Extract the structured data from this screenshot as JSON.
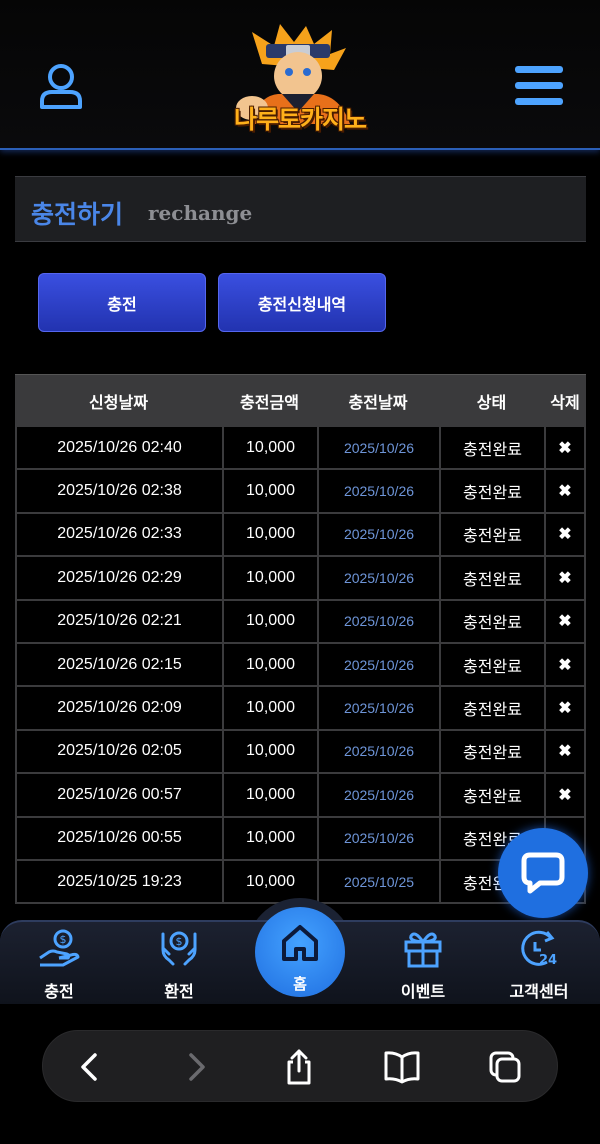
{
  "header": {
    "logo_text": "나루토카지노"
  },
  "page": {
    "title_ko": "충전하기",
    "title_en": "rechange"
  },
  "buttons": {
    "charge": "충전",
    "history": "충전신청내역"
  },
  "table": {
    "headers": [
      "신청날짜",
      "충전금액",
      "충전날짜",
      "상태",
      "삭제"
    ],
    "rows": [
      {
        "requested": "2025/10/26 02:40",
        "amount": "10,000",
        "charged": "2025/10/26",
        "status": "충전완료",
        "delete": "✖"
      },
      {
        "requested": "2025/10/26 02:38",
        "amount": "10,000",
        "charged": "2025/10/26",
        "status": "충전완료",
        "delete": "✖"
      },
      {
        "requested": "2025/10/26 02:33",
        "amount": "10,000",
        "charged": "2025/10/26",
        "status": "충전완료",
        "delete": "✖"
      },
      {
        "requested": "2025/10/26 02:29",
        "amount": "10,000",
        "charged": "2025/10/26",
        "status": "충전완료",
        "delete": "✖"
      },
      {
        "requested": "2025/10/26 02:21",
        "amount": "10,000",
        "charged": "2025/10/26",
        "status": "충전완료",
        "delete": "✖"
      },
      {
        "requested": "2025/10/26 02:15",
        "amount": "10,000",
        "charged": "2025/10/26",
        "status": "충전완료",
        "delete": "✖"
      },
      {
        "requested": "2025/10/26 02:09",
        "amount": "10,000",
        "charged": "2025/10/26",
        "status": "충전완료",
        "delete": "✖"
      },
      {
        "requested": "2025/10/26 02:05",
        "amount": "10,000",
        "charged": "2025/10/26",
        "status": "충전완료",
        "delete": "✖"
      },
      {
        "requested": "2025/10/26 00:57",
        "amount": "10,000",
        "charged": "2025/10/26",
        "status": "충전완료",
        "delete": "✖"
      },
      {
        "requested": "2025/10/26 00:55",
        "amount": "10,000",
        "charged": "2025/10/26",
        "status": "충전완료",
        "delete": ""
      },
      {
        "requested": "2025/10/25 19:23",
        "amount": "10,000",
        "charged": "2025/10/25",
        "status": "충전완료",
        "delete": ""
      }
    ]
  },
  "bottom_nav": {
    "items": [
      {
        "label": "충전",
        "icon": "hand-coin-icon"
      },
      {
        "label": "환전",
        "icon": "hands-dollar-icon"
      },
      {
        "label": "홈",
        "icon": "home-icon"
      },
      {
        "label": "이벤트",
        "icon": "gift-icon"
      },
      {
        "label": "고객센터",
        "icon": "support-24-icon"
      }
    ]
  },
  "browser": {
    "icons": [
      "back-icon",
      "forward-icon",
      "share-icon",
      "bookmarks-icon",
      "tabs-icon"
    ]
  },
  "colors": {
    "accent": "#4a86e8",
    "button": "#2f44d0",
    "fab": "#1f6fe0",
    "date_link": "#6e95d8"
  }
}
